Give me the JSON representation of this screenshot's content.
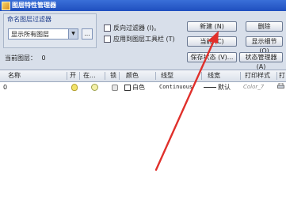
{
  "window": {
    "title": "图层特性管理器"
  },
  "filter": {
    "group_label": "命名图层过滤器",
    "selected": "显示所有图层",
    "dots_label": "..."
  },
  "options": {
    "invert_filter": "反向过滤器 (I)。",
    "apply_toolbar": "应用到图层工具栏 (T)"
  },
  "buttons": {
    "new": "新建 (N)",
    "delete": "删除",
    "current": "当前 (C)",
    "show_details": "显示细节 (Q)",
    "save_state": "保存状态 (V)...",
    "state_manager": "状态管理器 (A)"
  },
  "current_layer": {
    "label": "当前图层：",
    "value": "0"
  },
  "columns": [
    "名称",
    "开",
    "在...",
    "锁",
    "颜色",
    "线型",
    "线宽",
    "打印样式",
    "打"
  ],
  "layers": [
    {
      "name": "0",
      "color": "白色",
      "linetype": "Continuous",
      "lineweight": "默认",
      "plot_style": "Color_7"
    }
  ],
  "colors": {
    "titlebar": "#1f4fbf",
    "window_bg": "#d8dfea",
    "arrow": "#e0302b"
  },
  "icons": {
    "title": "app-icon",
    "on": "lightbulb-icon",
    "freeze": "sun-icon",
    "lock": "lock-icon",
    "print": "printer-icon"
  }
}
